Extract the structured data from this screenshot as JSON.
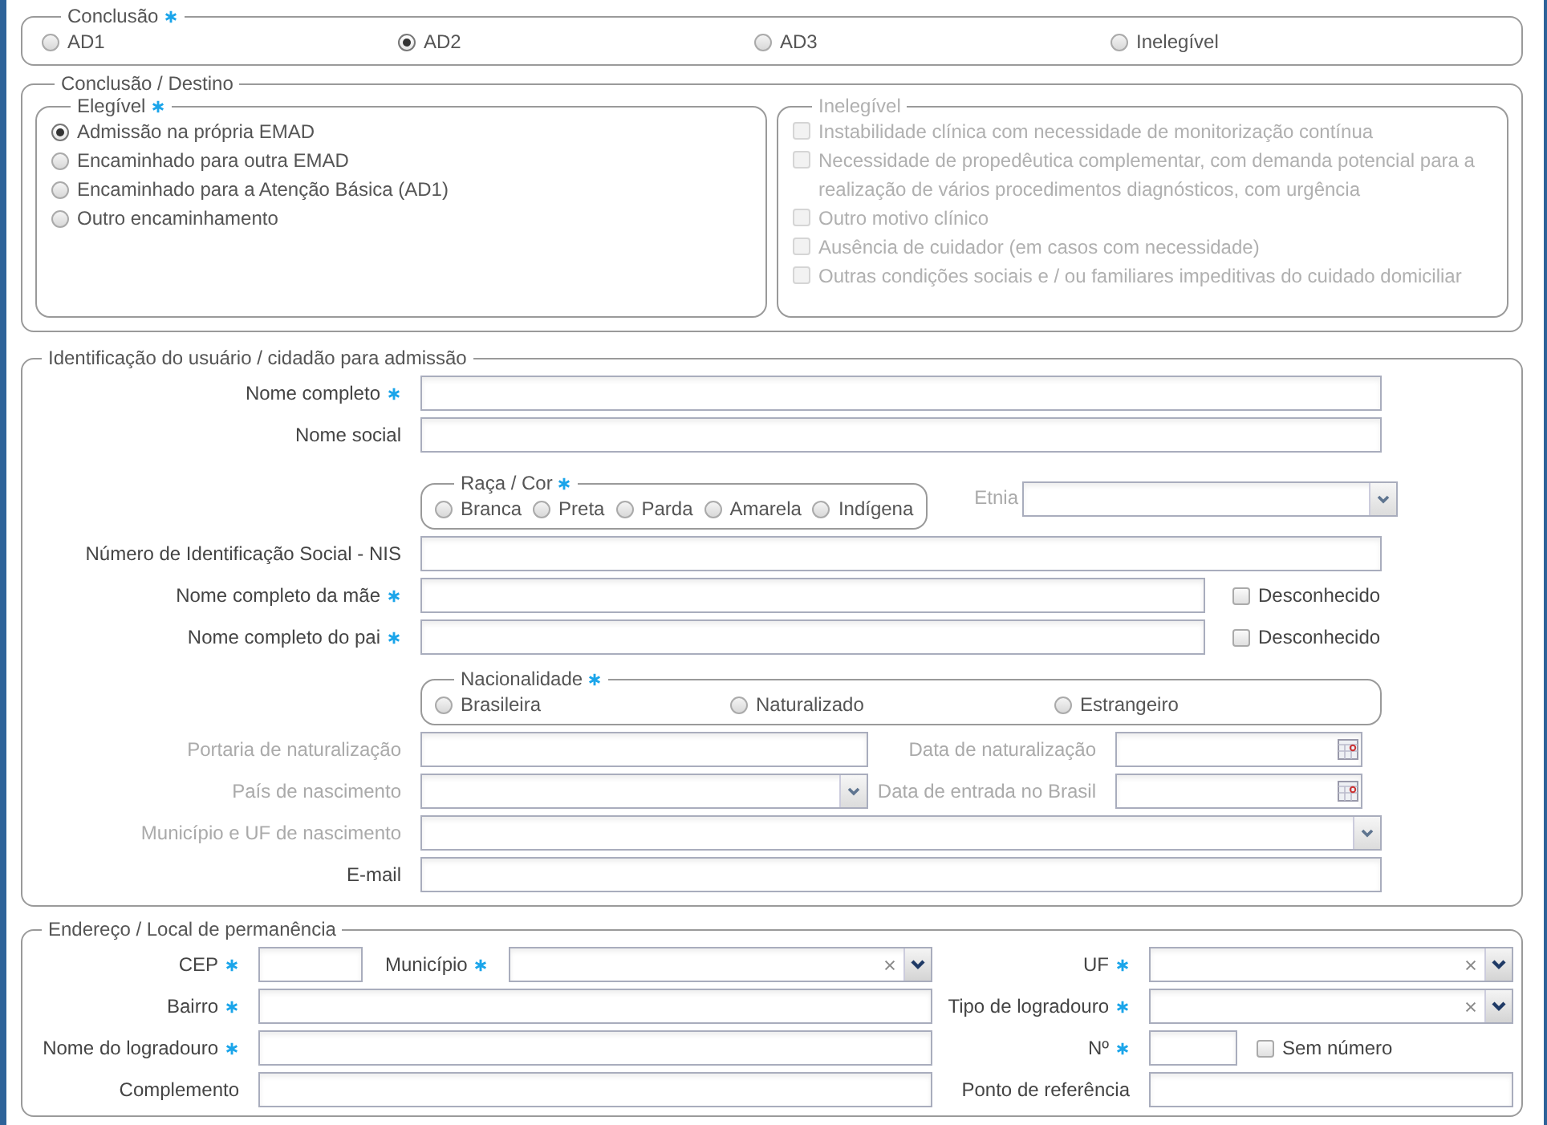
{
  "conclusao": {
    "legend": "Conclusão",
    "required": true,
    "options": [
      {
        "label": "AD1",
        "selected": false
      },
      {
        "label": "AD2",
        "selected": true
      },
      {
        "label": "AD3",
        "selected": false
      },
      {
        "label": "Inelegível",
        "selected": false
      }
    ]
  },
  "destino": {
    "legend": "Conclusão / Destino",
    "elegivel": {
      "legend": "Elegível",
      "required": true,
      "options": [
        {
          "label": "Admissão na própria EMAD",
          "selected": true
        },
        {
          "label": "Encaminhado para outra EMAD",
          "selected": false
        },
        {
          "label": "Encaminhado para a Atenção Básica (AD1)",
          "selected": false
        },
        {
          "label": "Outro encaminhamento",
          "selected": false
        }
      ]
    },
    "inelegivel": {
      "legend": "Inelegível",
      "disabled": true,
      "options": [
        {
          "label": "Instabilidade clínica com necessidade de monitorização contínua",
          "checked": false
        },
        {
          "label": "Necessidade de propedêutica complementar, com demanda potencial para a realização de vários procedimentos diagnósticos, com urgência",
          "checked": false
        },
        {
          "label": "Outro motivo clínico",
          "checked": false
        },
        {
          "label": "Ausência de cuidador (em casos com necessidade)",
          "checked": false
        },
        {
          "label": "Outras condições sociais e / ou familiares impeditivas do cuidado domiciliar",
          "checked": false
        }
      ]
    }
  },
  "identificacao": {
    "legend": "Identificação do usuário / cidadão para admissão",
    "nome_completo": {
      "label": "Nome completo",
      "required": true
    },
    "nome_social": {
      "label": "Nome social"
    },
    "raca_cor": {
      "legend": "Raça / Cor",
      "required": true,
      "options": [
        {
          "label": "Branca",
          "selected": false
        },
        {
          "label": "Preta",
          "selected": false
        },
        {
          "label": "Parda",
          "selected": false
        },
        {
          "label": "Amarela",
          "selected": false
        },
        {
          "label": "Indígena",
          "selected": false
        }
      ]
    },
    "etnia": {
      "label": "Etnia",
      "disabled": true
    },
    "nis": {
      "label": "Número de Identificação Social - NIS"
    },
    "nome_mae": {
      "label": "Nome completo da mãe",
      "required": true,
      "unknown": {
        "label": "Desconhecido",
        "checked": false
      }
    },
    "nome_pai": {
      "label": "Nome completo do pai",
      "required": true,
      "unknown": {
        "label": "Desconhecido",
        "checked": false
      }
    },
    "nacionalidade": {
      "legend": "Nacionalidade",
      "required": true,
      "options": [
        {
          "label": "Brasileira",
          "selected": false
        },
        {
          "label": "Naturalizado",
          "selected": false
        },
        {
          "label": "Estrangeiro",
          "selected": false
        }
      ]
    },
    "portaria": {
      "label": "Portaria de naturalização",
      "disabled": true
    },
    "data_naturalizacao": {
      "label": "Data de naturalização",
      "disabled": true
    },
    "pais_nascimento": {
      "label": "País de nascimento",
      "disabled": true
    },
    "data_entrada": {
      "label": "Data de entrada no Brasil",
      "disabled": true
    },
    "municipio_uf": {
      "label": "Município e UF de nascimento",
      "disabled": true
    },
    "email": {
      "label": "E-mail"
    }
  },
  "endereco": {
    "legend": "Endereço / Local de permanência",
    "cep": {
      "label": "CEP",
      "required": true
    },
    "municipio": {
      "label": "Município",
      "required": true
    },
    "uf": {
      "label": "UF",
      "required": true
    },
    "bairro": {
      "label": "Bairro",
      "required": true
    },
    "tipo_logradouro": {
      "label": "Tipo de logradouro",
      "required": true
    },
    "nome_logradouro": {
      "label": "Nome do logradouro",
      "required": true
    },
    "numero": {
      "label": "Nº",
      "required": true,
      "sem_numero": {
        "label": "Sem número",
        "checked": false
      }
    },
    "complemento": {
      "label": "Complemento"
    },
    "ponto_referencia": {
      "label": "Ponto de referência"
    }
  }
}
